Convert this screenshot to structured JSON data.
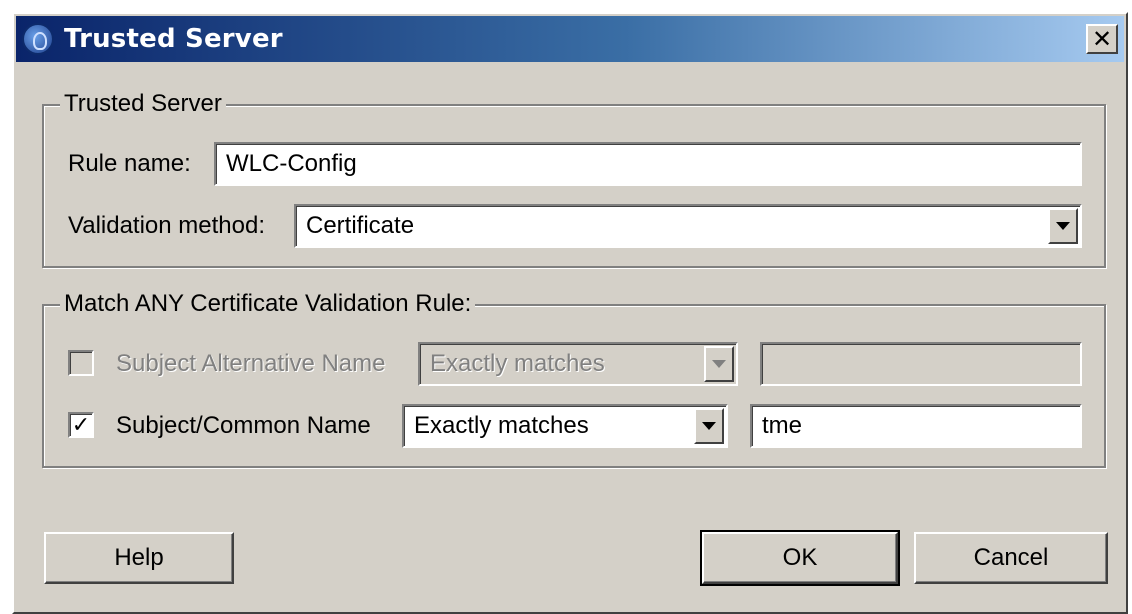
{
  "window": {
    "title": "Trusted Server",
    "close_label": "✕"
  },
  "trusted_server_group": {
    "legend": "Trusted Server",
    "rule_name_label": "Rule name:",
    "rule_name_value": "WLC-Config",
    "validation_method_label": "Validation method:",
    "validation_method_value": "Certificate"
  },
  "match_group": {
    "legend": "Match ANY Certificate Validation Rule:",
    "rows": [
      {
        "checked": false,
        "enabled": false,
        "check_mark": "",
        "label": "Subject Alternative Name",
        "match_mode": "Exactly matches",
        "value": ""
      },
      {
        "checked": true,
        "enabled": true,
        "check_mark": "✓",
        "label": "Subject/Common Name",
        "match_mode": "Exactly matches",
        "value": "tme"
      }
    ]
  },
  "buttons": {
    "help": "Help",
    "ok": "OK",
    "cancel": "Cancel"
  },
  "icons": {
    "title": "globe-icon",
    "close": "close-icon",
    "dropdown": "chevron-down-icon",
    "checkbox": "check-icon"
  },
  "colors": {
    "title_bar_start": "#0a246a",
    "title_bar_end": "#a6caf0",
    "face": "#d4d0c8"
  }
}
